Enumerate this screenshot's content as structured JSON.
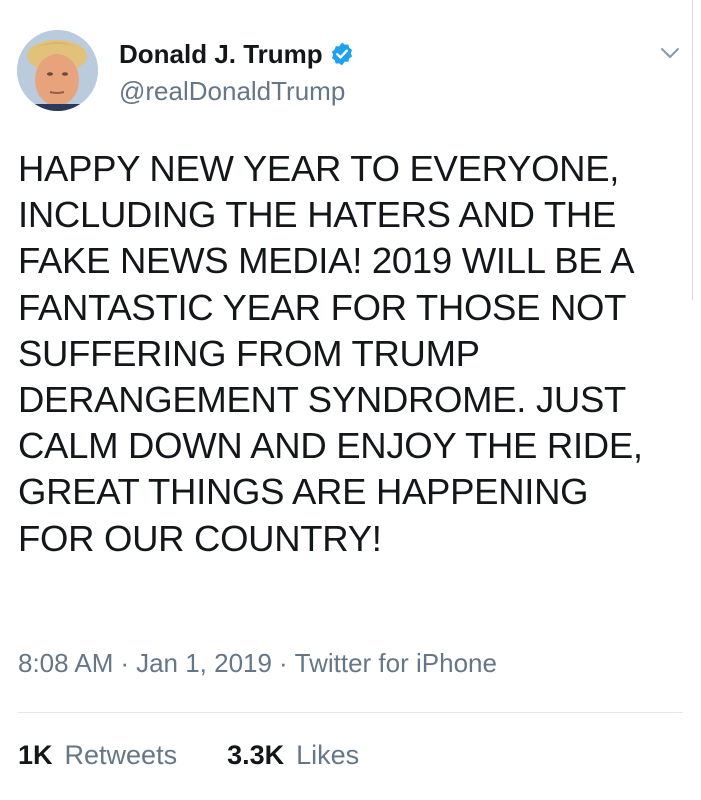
{
  "author": {
    "display_name": "Donald J. Trump",
    "handle": "@realDonaldTrump",
    "verified": true
  },
  "icons": {
    "verified": "verified-badge-icon",
    "menu": "chevron-down-icon"
  },
  "tweet": {
    "text": "HAPPY NEW YEAR TO EVERYONE,\nINCLUDING THE HATERS AND THE\nFAKE NEWS MEDIA! 2019 WILL BE A\nFANTASTIC YEAR FOR THOSE NOT\nSUFFERING FROM TRUMP\nDERANGEMENT SYNDROME. JUST\nCALM DOWN AND ENJOY THE RIDE,\nGREAT THINGS ARE HAPPENING\nFOR OUR COUNTRY!",
    "time": "8:08 AM",
    "date": "Jan 1, 2019",
    "source": "Twitter for iPhone",
    "separator": "·"
  },
  "stats": {
    "retweets_count": "1K",
    "retweets_label": "Retweets",
    "likes_count": "3.3K",
    "likes_label": "Likes"
  },
  "colors": {
    "verified_blue": "#1da1f2",
    "secondary_text": "#657786",
    "primary_text": "#14171a"
  }
}
